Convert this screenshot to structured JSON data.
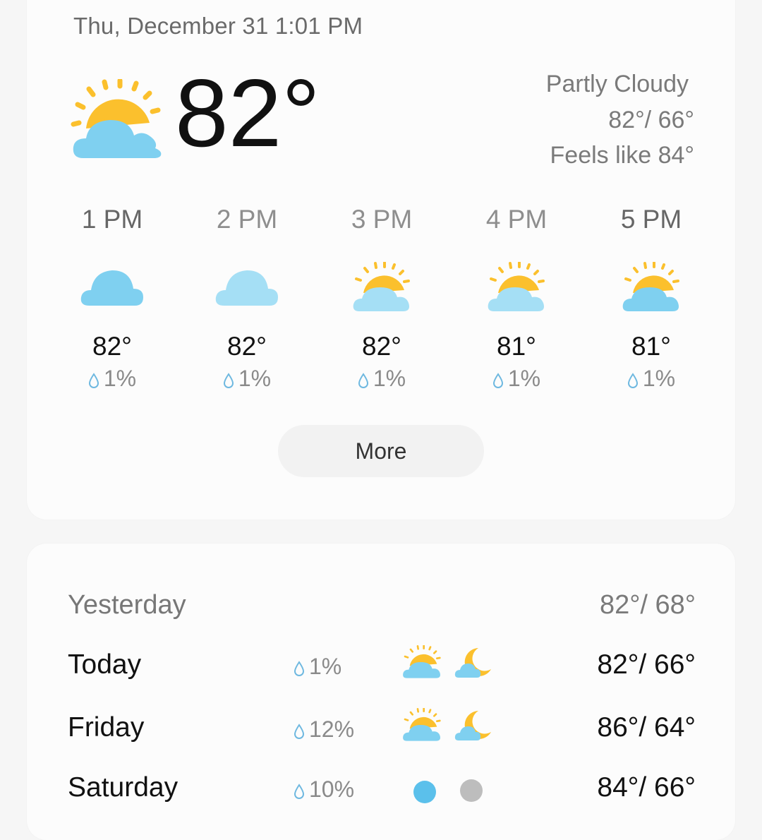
{
  "current": {
    "datetime": "Thu, December 31 1:01 PM",
    "temperature": "82°",
    "condition": "Partly Cloudy",
    "hi_lo": "82°/ 66°",
    "feels_like": "Feels like 84°",
    "icon": "partly-cloudy-icon"
  },
  "hourly": [
    {
      "time": "1 PM",
      "temp": "82°",
      "precip": "1%",
      "icon": "cloudy-icon"
    },
    {
      "time": "2 PM",
      "temp": "82°",
      "precip": "1%",
      "icon": "cloudy-icon"
    },
    {
      "time": "3 PM",
      "temp": "82°",
      "precip": "1%",
      "icon": "partly-cloudy-icon"
    },
    {
      "time": "4 PM",
      "temp": "81°",
      "precip": "1%",
      "icon": "partly-cloudy-icon"
    },
    {
      "time": "5 PM",
      "temp": "81°",
      "precip": "1%",
      "icon": "partly-cloudy-icon"
    }
  ],
  "more_label": "More",
  "daily": [
    {
      "day": "Yesterday",
      "temps": "82°/ 68°"
    },
    {
      "day": "Today",
      "precip": "1%",
      "temps": "82°/ 66°",
      "day_icon": "partly-cloudy-icon",
      "night_icon": "moon-cloud-icon"
    },
    {
      "day": "Friday",
      "precip": "12%",
      "temps": "86°/ 64°",
      "day_icon": "partly-cloudy-icon",
      "night_icon": "moon-cloud-icon"
    },
    {
      "day": "Saturday",
      "precip": "10%",
      "temps": "84°/ 66°",
      "day_icon": "cloudy-icon",
      "night_icon": "gray-cloud-icon"
    }
  ],
  "colors": {
    "sun": "#FBC02D",
    "cloud": "#7FD0F0",
    "cloud_light": "#A5DFF5",
    "moon": "#FBC02D",
    "drop": "#6EB8E0"
  }
}
